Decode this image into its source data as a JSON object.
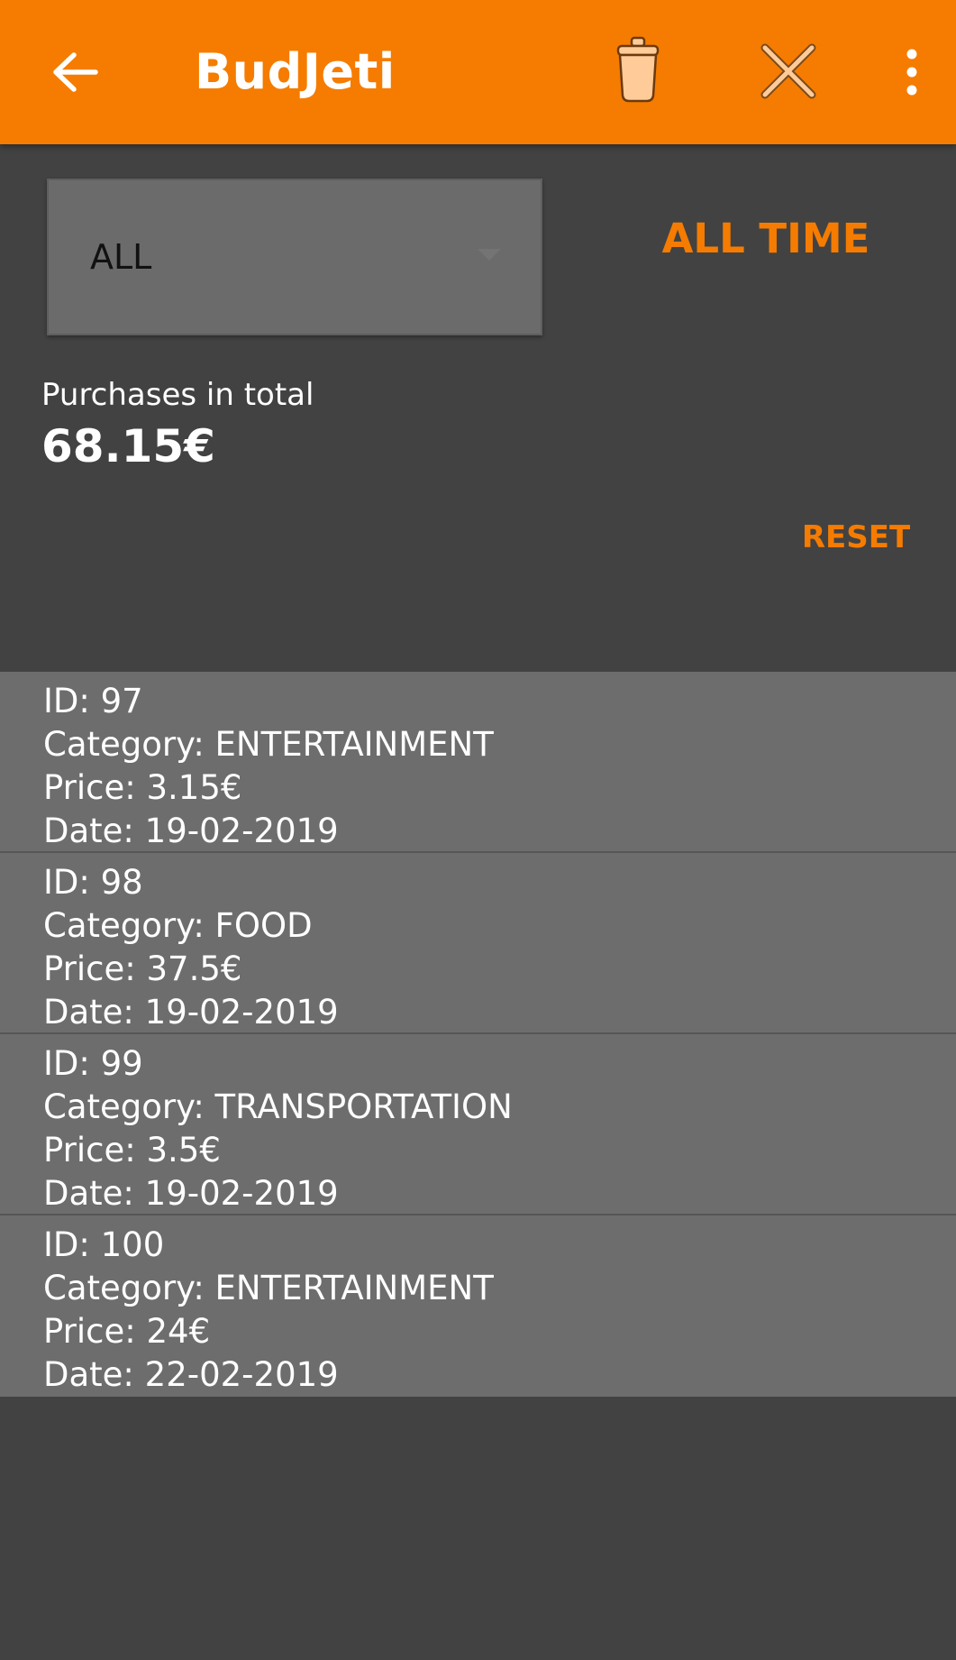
{
  "app_bar": {
    "title": "BudJeti",
    "back_icon": "arrow-back-icon",
    "trash_icon": "trash-can-icon",
    "close_icon": "close-x-icon",
    "menu_icon": "more-vert-icon"
  },
  "filter": {
    "category_selected": "ALL",
    "period_label": "ALL TIME"
  },
  "summary": {
    "label": "Purchases in total",
    "total": "68.15€",
    "reset_label": "RESET"
  },
  "purchases": [
    {
      "id": "ID: 97",
      "category": "Category: ENTERTAINMENT",
      "price": "Price: 3.15€",
      "date": "Date: 19-02-2019"
    },
    {
      "id": "ID: 98",
      "category": "Category: FOOD",
      "price": "Price: 37.5€",
      "date": "Date: 19-02-2019"
    },
    {
      "id": "ID: 99",
      "category": "Category: TRANSPORTATION",
      "price": "Price: 3.5€",
      "date": "Date: 19-02-2019"
    },
    {
      "id": "ID: 100",
      "category": "Category: ENTERTAINMENT",
      "price": "Price: 24€",
      "date": "Date: 22-02-2019"
    }
  ],
  "colors": {
    "accent": "#F57C00",
    "background": "#424242",
    "row": "#6D6D6D"
  }
}
